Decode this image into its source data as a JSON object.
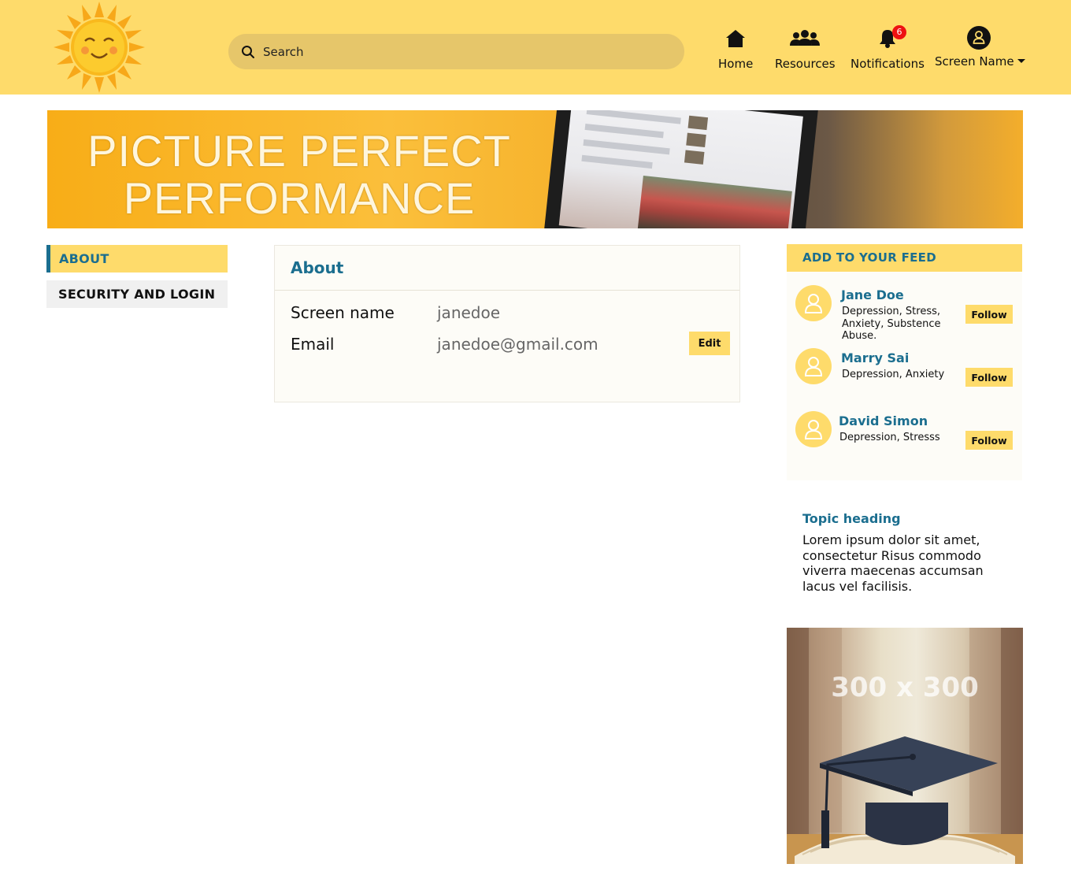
{
  "header": {
    "search": {
      "placeholder": "Search"
    },
    "nav": {
      "home": "Home",
      "resources": "Resources",
      "notifications": "Notifications",
      "notification_count": "6",
      "profile": "Screen Name"
    }
  },
  "banner": {
    "line1": "PICTURE PERFECT",
    "line2": "PERFORMANCE"
  },
  "sidebar": {
    "items": [
      {
        "label": "ABOUT",
        "active": true
      },
      {
        "label": "SECURITY AND LOGIN",
        "active": false
      }
    ]
  },
  "about": {
    "title": "About",
    "fields": [
      {
        "label": "Screen name",
        "value": "janedoe"
      },
      {
        "label": "Email",
        "value": "janedoe@gmail.com"
      }
    ],
    "edit_label": "Edit"
  },
  "feed": {
    "title": "ADD TO YOUR FEED",
    "follow_label": "Follow",
    "people": [
      {
        "name": "Jane Doe",
        "topics": "Depression, Stress, Anxiety, Substence Abuse."
      },
      {
        "name": "Marry Sai",
        "topics": "Depression, Anxiety"
      },
      {
        "name": "David Simon",
        "topics": "Depression, Stresss"
      }
    ]
  },
  "topic": {
    "heading": "Topic heading",
    "text": "Lorem ipsum dolor sit amet, consectetur   Risus commodo viverra maecenas accumsan lacus vel facilisis."
  },
  "ad": {
    "label": "300 x 300"
  },
  "colors": {
    "brand_yellow": "#fedb6b",
    "accent_blue": "#1b6e8f",
    "notification_red": "#e11111"
  }
}
